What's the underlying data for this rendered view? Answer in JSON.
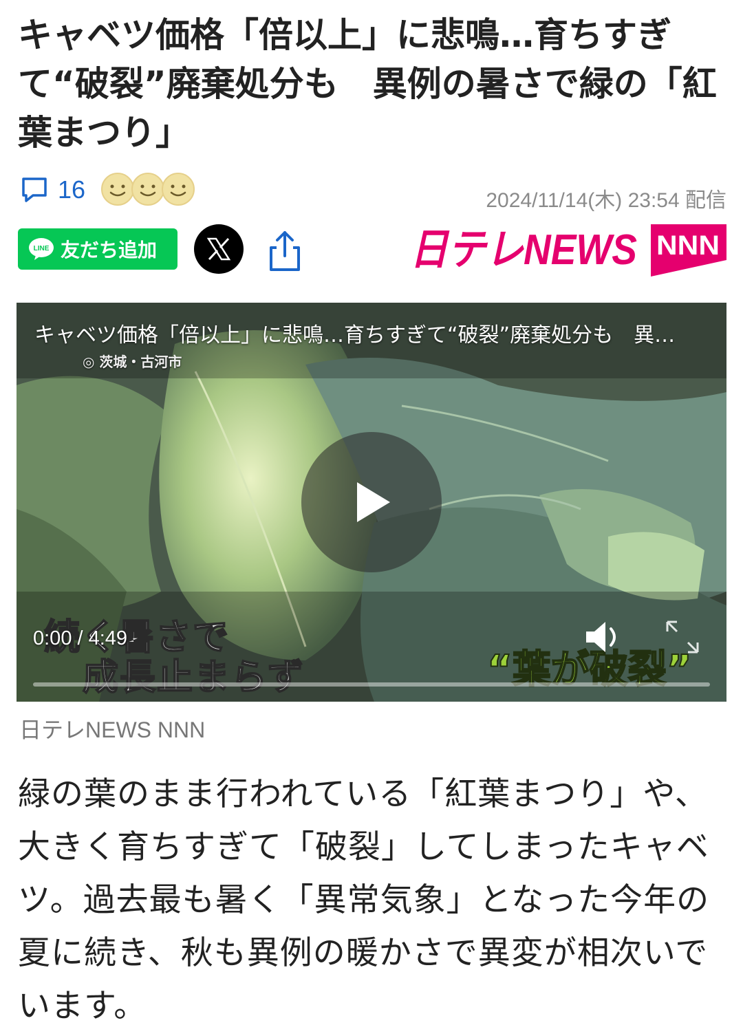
{
  "article": {
    "headline": "キャベツ価格「倍以上」に悲鳴…育ちすぎて“破裂”廃棄処分も　異例の暑さで緑の「紅葉まつり」",
    "comment_count": "16",
    "date": "2024/11/14(木) 23:54 配信",
    "source": "日テレNEWS NNN",
    "body": "緑の葉のまま行われている「紅葉まつり」や、大きく育ちすぎて「破裂」してしまったキャベツ。過去最も暑く「異常気象」となった今年の夏に続き、秋も異例の暖かさで異変が相次いでいます。"
  },
  "share": {
    "line_label": "友だち追加",
    "line_badge": "LINE"
  },
  "logo": {
    "brand": "日テレNEWS",
    "badge": "NNN",
    "color": "#e5006e"
  },
  "video": {
    "title": "キャベツ価格「倍以上」に悲鳴…育ちすぎて“破裂”廃棄処分も　異例の暑さで緑の「紅葉まつり」",
    "location": "◎ 茨城・古河市",
    "caption_line1": "続く暑さで",
    "caption_line2": "成長止まらず",
    "caption_right": "“葉が破裂”",
    "time": "0:00 / 4:49",
    "progress": 0
  },
  "colors": {
    "link_blue": "#1b66c9",
    "line_green": "#06c755",
    "date_gray": "#8a8a8a"
  },
  "icons": [
    "comment-icon",
    "reaction-face-icon",
    "line-icon",
    "x-logo-icon",
    "share-icon",
    "play-icon",
    "volume-icon",
    "expand-icon"
  ]
}
